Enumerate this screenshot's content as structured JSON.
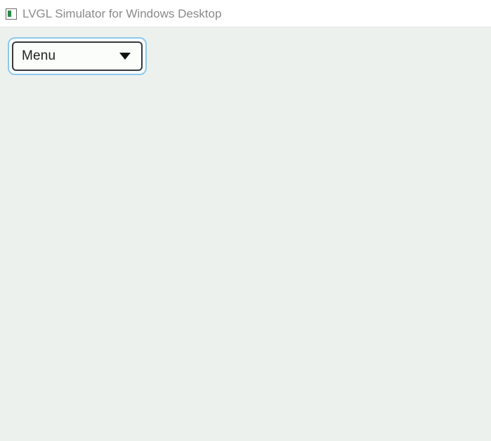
{
  "window": {
    "title": "LVGL Simulator for Windows Desktop",
    "icon": "app-icon"
  },
  "dropdown": {
    "selected_label": "Menu",
    "icon": "chevron-down-icon"
  },
  "colors": {
    "client_bg": "#edf1ee",
    "focus_ring": "#8ec9ee",
    "border_dark": "#39393a"
  }
}
